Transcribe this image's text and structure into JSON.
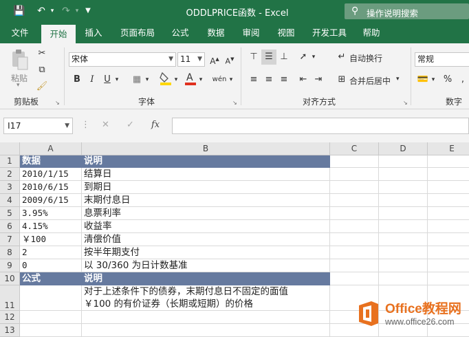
{
  "titlebar": {
    "title": "ODDLPRICE函数  -  Excel",
    "search_label": "操作说明搜索",
    "brand_color": "#217346"
  },
  "tabs": [
    "文件",
    "开始",
    "插入",
    "页面布局",
    "公式",
    "数据",
    "审阅",
    "视图",
    "开发工具",
    "帮助"
  ],
  "ribbon": {
    "clipboard": {
      "paste_label": "粘贴",
      "group_label": "剪贴板"
    },
    "font": {
      "font_name": "宋体",
      "font_size": "11",
      "group_label": "字体"
    },
    "alignment": {
      "wrap_label": "自动换行",
      "merge_label": "合并后居中",
      "group_label": "对齐方式"
    },
    "number": {
      "format": "常规",
      "group_label": "数字"
    }
  },
  "formula_bar": {
    "name_box": "I17",
    "formula": ""
  },
  "grid": {
    "columns": [
      "A",
      "B",
      "C",
      "D",
      "E"
    ],
    "rows": [
      {
        "num": "1",
        "a": "数据",
        "b": "说明"
      },
      {
        "num": "2",
        "a": "2010/1/15",
        "b": "结算日"
      },
      {
        "num": "3",
        "a": "2010/6/15",
        "b": "到期日"
      },
      {
        "num": "4",
        "a": "2009/6/15",
        "b": "末期付息日"
      },
      {
        "num": "5",
        "a": "3.95%",
        "b": "息票利率"
      },
      {
        "num": "6",
        "a": "4.15%",
        "b": "收益率"
      },
      {
        "num": "7",
        "a": "￥100",
        "b": "清偿价值"
      },
      {
        "num": "8",
        "a": "2",
        "b": "按半年期支付"
      },
      {
        "num": "9",
        "a": "0",
        "b": "以 30/360 为日计数基准"
      },
      {
        "num": "10",
        "a": "公式",
        "b": "说明"
      },
      {
        "num": "11",
        "a": "",
        "b": "对于上述条件下的债券，末期付息日不固定的面值",
        "b2": "￥100 的有价证券（长期或短期）的价格"
      },
      {
        "num": "12",
        "a": "",
        "b": ""
      },
      {
        "num": "13",
        "a": "",
        "b": ""
      }
    ],
    "header_fill": "#667a9f"
  },
  "watermark": {
    "brand": "Office教程网",
    "url": "www.office26.com"
  }
}
